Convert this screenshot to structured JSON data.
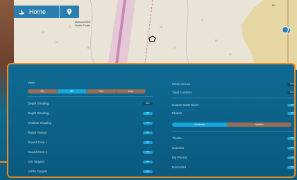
{
  "nav": {
    "home_label": "Home"
  },
  "map": {
    "labels": [
      "Diamond Reef",
      "Marble Trestle",
      "Rd"
    ]
  },
  "panel": {
    "left": {
      "view_title": "View",
      "view_options": [
        "2D",
        "3D",
        "Fish",
        "Gray"
      ],
      "view_active_index": 1,
      "rows": [
        {
          "label": "Depth Shading",
          "state": "OFF"
        },
        {
          "label": "Depth Shading",
          "state": "ON"
        },
        {
          "label": "Shallow Shading",
          "state": "ON"
        },
        {
          "label": "Radar Range",
          "state": "ON"
        },
        {
          "label": "Guard Zone 1",
          "state": "ON"
        },
        {
          "label": "Guard Zone 2",
          "state": "ON"
        },
        {
          "label": "AIS Targets",
          "state": "ON"
        },
        {
          "label": "ARPA Targets",
          "state": "ON"
        }
      ]
    },
    "right": {
      "top_rows": [
        {
          "label": "Wind Arrows",
          "state": "OFF"
        },
        {
          "label": "Tidal Currents",
          "state": "OFF"
        },
        {
          "label": "Course Extensions",
          "state": "ON"
        },
        {
          "label": "Photos",
          "state": "ON"
        }
      ],
      "slider": {
        "fill_label": "Contours",
        "rest_label": "Satellite",
        "fill_fraction": 0.46
      },
      "bottom_rows": [
        {
          "label": "Tracks",
          "state": "ON"
        },
        {
          "label": "Courses",
          "state": "ON"
        },
        {
          "label": "My Photos",
          "state": "ON"
        },
        {
          "label": "Recorded",
          "state": "ON"
        }
      ]
    }
  },
  "colors": {
    "accent": "#1aa6dc",
    "highlight": "#f08c1e",
    "panel": "#0c5e84"
  }
}
